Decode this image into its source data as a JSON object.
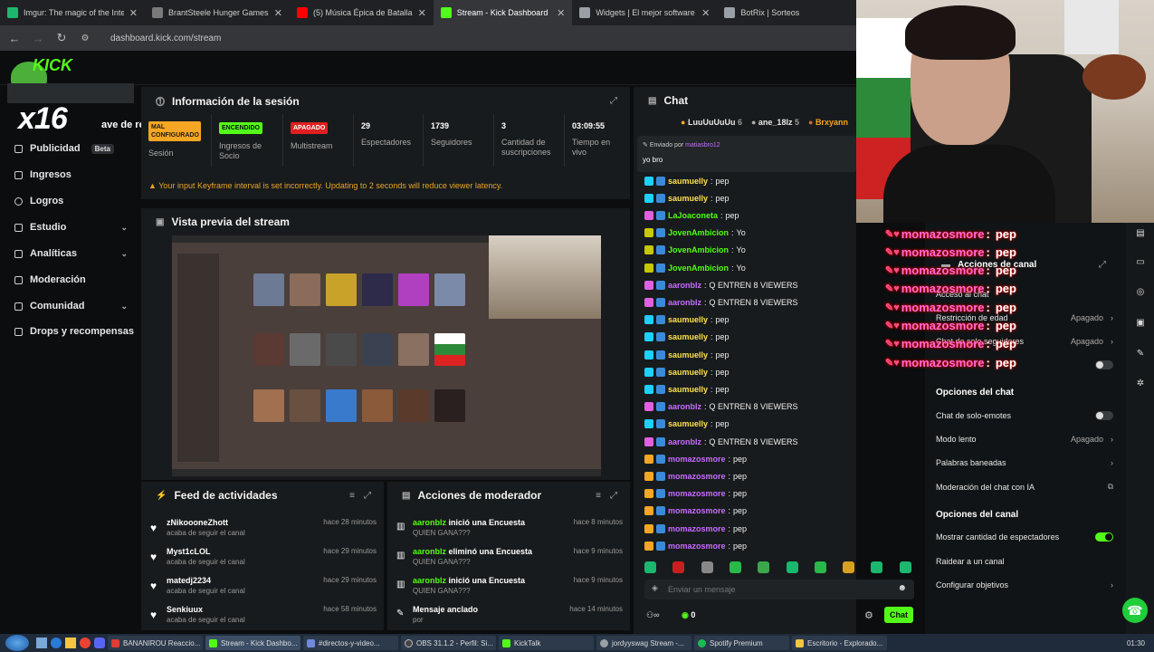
{
  "browser": {
    "tabs": [
      {
        "title": "Imgur: The magic of the Interne",
        "color": "#1bb76e"
      },
      {
        "title": "BrantSteele Hunger Games Sim",
        "color": "#7a7a7a"
      },
      {
        "title": "(5) Música Épica de Batalla",
        "color": "#ff0000"
      },
      {
        "title": "Stream - Kick Dashboard",
        "color": "#53fc18"
      },
      {
        "title": "Widgets | El mejor software pa",
        "color": "#9aa0a6"
      },
      {
        "title": "BotRix | Sorteos",
        "color": "#9aa0a6"
      }
    ],
    "url": "dashboard.kick.com/stream"
  },
  "logo": {
    "brand": "KICK",
    "overlay_text": "x16",
    "partial_label": "ave de retran"
  },
  "sidebar": {
    "items": [
      {
        "label": "Publicidad",
        "badge": "Beta"
      },
      {
        "label": "Ingresos"
      },
      {
        "label": "Logros"
      },
      {
        "label": "Estudio"
      },
      {
        "label": "Analíticas"
      },
      {
        "label": "Moderación"
      },
      {
        "label": "Comunidad"
      },
      {
        "label": "Drops y recompensas"
      }
    ]
  },
  "session": {
    "title": "Información de la sesión",
    "stats": [
      {
        "value": "MAL CONFIGURADO",
        "label": "Sesión",
        "badge_color": "#f5a623"
      },
      {
        "value": "ENCENDIDO",
        "label": "Ingresos de Socio",
        "badge_color": "#53fc18"
      },
      {
        "value": "APAGADO",
        "label": "Multistream",
        "badge_color": "#e02020"
      },
      {
        "value": "29",
        "label": "Espectadores"
      },
      {
        "value": "1739",
        "label": "Seguidores"
      },
      {
        "value": "3",
        "label": "Cantidad de suscripciones"
      },
      {
        "value": "03:09:55",
        "label": "Tiempo en vivo"
      }
    ],
    "warning": "Your input Keyframe interval is set incorrectly. Updating to 2 seconds will reduce viewer latency."
  },
  "preview": {
    "title": "Vista previa del stream"
  },
  "feed": {
    "title": "Feed de actividades",
    "items": [
      {
        "name": "zNikoooneZhott",
        "action": "acaba de seguir el canal",
        "time": "hace 28 minutos"
      },
      {
        "name": "Myst1cLOL",
        "action": "acaba de seguir el canal",
        "time": "hace 29 minutos"
      },
      {
        "name": "matedj2234",
        "action": "acaba de seguir el canal",
        "time": "hace 29 minutos"
      },
      {
        "name": "Senkiuux",
        "action": "acaba de seguir el canal",
        "time": "hace 58 minutos"
      }
    ]
  },
  "modactions": {
    "title": "Acciones de moderador",
    "items": [
      {
        "user": "aaronblz",
        "action": "inició una Encuesta",
        "sub": "QUIEN GANA???",
        "time": "hace 8 minutos"
      },
      {
        "user": "aaronblz",
        "action": "eliminó una Encuesta",
        "sub": "QUIEN GANA???",
        "time": "hace 9 minutos"
      },
      {
        "user": "aaronblz",
        "action": "inició una Encuesta",
        "sub": "QUIEN GANA???",
        "time": "hace 9 minutos"
      },
      {
        "user": "",
        "action": "Mensaje anclado",
        "sub": "por aaronblz",
        "time": "hace 14 minutos"
      }
    ]
  },
  "chat": {
    "title": "Chat",
    "top_gifters": [
      {
        "name": "LuuUuUuUu",
        "count": "6"
      },
      {
        "name": "ane_18lz",
        "count": "5"
      },
      {
        "name": "Brxyann",
        "count": ""
      }
    ],
    "pinned": {
      "by_label": "Enviado por",
      "by": "matiasbro12",
      "text": "yo bro"
    },
    "messages": [
      {
        "user": "saumuelly",
        "text": "pep",
        "color": "#ffe14d",
        "badge": "#1bd1ff"
      },
      {
        "user": "saumuelly",
        "text": "pep",
        "color": "#ffe14d",
        "badge": "#1bd1ff"
      },
      {
        "user": "LaJoaconeta",
        "text": "pep",
        "color": "#53fc18",
        "badge": "#e060e0"
      },
      {
        "user": "JovenAmbicion",
        "text": "Yo",
        "color": "#53fc18",
        "badge": "#c8c800"
      },
      {
        "user": "JovenAmbicion",
        "text": "Yo",
        "color": "#53fc18",
        "badge": "#c8c800"
      },
      {
        "user": "JovenAmbicion",
        "text": "Yo",
        "color": "#53fc18",
        "badge": "#c8c800"
      },
      {
        "user": "aaronblz",
        "text": "Q ENTREN 8 VIEWERS",
        "color": "#c86bff",
        "badge": "#e060e0"
      },
      {
        "user": "aaronblz",
        "text": "Q ENTREN 8 VIEWERS",
        "color": "#c86bff",
        "badge": "#e060e0"
      },
      {
        "user": "saumuelly",
        "text": "pep",
        "color": "#ffe14d",
        "badge": "#1bd1ff"
      },
      {
        "user": "saumuelly",
        "text": "pep",
        "color": "#ffe14d",
        "badge": "#1bd1ff"
      },
      {
        "user": "saumuelly",
        "text": "pep",
        "color": "#ffe14d",
        "badge": "#1bd1ff"
      },
      {
        "user": "saumuelly",
        "text": "pep",
        "color": "#ffe14d",
        "badge": "#1bd1ff"
      },
      {
        "user": "saumuelly",
        "text": "pep",
        "color": "#ffe14d",
        "badge": "#1bd1ff"
      },
      {
        "user": "aaronblz",
        "text": "Q ENTREN 8 VIEWERS",
        "color": "#c86bff",
        "badge": "#e060e0"
      },
      {
        "user": "saumuelly",
        "text": "pep",
        "color": "#ffe14d",
        "badge": "#1bd1ff"
      },
      {
        "user": "aaronblz",
        "text": "Q ENTREN 8 VIEWERS",
        "color": "#c86bff",
        "badge": "#e060e0"
      },
      {
        "user": "momazosmore",
        "text": "pep",
        "color": "#c86bff",
        "badge": "#f5a623"
      },
      {
        "user": "momazosmore",
        "text": "pep",
        "color": "#c86bff",
        "badge": "#f5a623"
      },
      {
        "user": "momazosmore",
        "text": "pep",
        "color": "#c86bff",
        "badge": "#f5a623"
      },
      {
        "user": "momazosmore",
        "text": "pep",
        "color": "#c86bff",
        "badge": "#f5a623"
      },
      {
        "user": "momazosmore",
        "text": "pep",
        "color": "#c86bff",
        "badge": "#f5a623"
      },
      {
        "user": "momazosmore",
        "text": "pep",
        "color": "#c86bff",
        "badge": "#f5a623"
      }
    ],
    "input_placeholder": "Enviar un mensaje",
    "points": "0",
    "send_label": "Chat"
  },
  "overlay_chat": {
    "lines": [
      {
        "user": "momazosmore",
        "text": "pep"
      },
      {
        "user": "momazosmore",
        "text": "pep"
      },
      {
        "user": "momazosmore",
        "text": "pep"
      },
      {
        "user": "momazosmore",
        "text": "pep"
      },
      {
        "user": "momazosmore",
        "text": "pep"
      },
      {
        "user": "momazosmore",
        "text": "pep"
      },
      {
        "user": "momazosmore",
        "text": "pep"
      },
      {
        "user": "momazosmore",
        "text": "pep"
      }
    ]
  },
  "channel_actions": {
    "title": "Acciones de canal",
    "partial_rows": [
      {
        "label": "Acceso al chat",
        "value": ""
      },
      {
        "label": "Restricción de edad",
        "value": "Apagado"
      },
      {
        "label": "Chat de solo seguidores",
        "value": "Apagado"
      }
    ],
    "chat_options": {
      "title": "Opciones del chat",
      "rows": [
        {
          "label": "Chat de solo-emotes",
          "value": "toggle-off"
        },
        {
          "label": "Modo lento",
          "value": "Apagado"
        },
        {
          "label": "Palabras baneadas",
          "value": ""
        },
        {
          "label": "Moderación del chat con IA",
          "value": ""
        }
      ]
    },
    "channel_options": {
      "title": "Opciones del canal",
      "rows": [
        {
          "label": "Mostrar cantidad de espectadores",
          "value": "toggle-on"
        },
        {
          "label": "Raidear a un canal",
          "value": ""
        },
        {
          "label": "Configurar objetivos",
          "value": ""
        }
      ]
    }
  },
  "taskbar": {
    "items": [
      {
        "label": "BANANIROU Reaccio...",
        "color": "#e53935"
      },
      {
        "label": "Stream - Kick Dashbo...",
        "color": "#53fc18"
      },
      {
        "label": "#directos-y-video...",
        "color": "#7289da"
      },
      {
        "label": "OBS 31.1.2 - Perfil: Si...",
        "color": "#444"
      },
      {
        "label": "KickTalk",
        "color": "#53fc18"
      },
      {
        "label": "jordyyswag Stream -...",
        "color": "#9aa0a6"
      },
      {
        "label": "Spotify Premium",
        "color": "#1db954"
      },
      {
        "label": "Escritorio - Explorado...",
        "color": "#f5c542"
      }
    ],
    "clock": "01:30"
  }
}
